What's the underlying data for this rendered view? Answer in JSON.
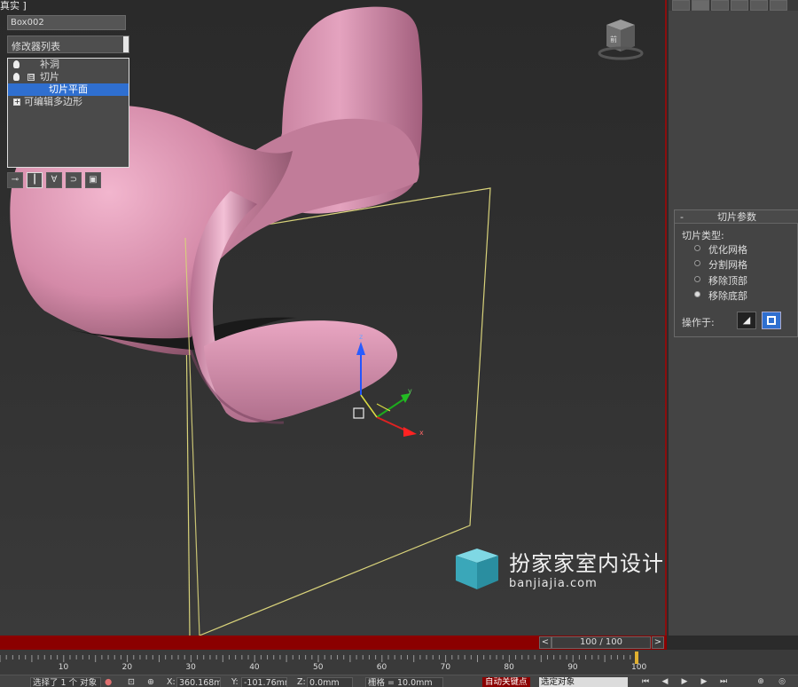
{
  "viewport": {
    "label": "真实 ]",
    "viewcube_label": "前",
    "axes": {
      "x": "x",
      "y": "y",
      "z": "z"
    }
  },
  "watermark": {
    "title": "扮家家室内设计",
    "url": "banjiajia.com"
  },
  "command_panel": {
    "object_name": "Box002",
    "modifier_list": "修改器列表",
    "stack": [
      {
        "label": "补洞"
      },
      {
        "label": "切片",
        "expand": "⊟"
      },
      {
        "label": "切片平面",
        "selected": true
      },
      {
        "label": "可编辑多边形",
        "expand": "+"
      }
    ],
    "rollout": {
      "title": "切片参数",
      "collapse": "-",
      "slice_type_label": "切片类型:",
      "options": [
        {
          "label": "优化网格",
          "selected": false
        },
        {
          "label": "分割网格",
          "selected": false
        },
        {
          "label": "移除顶部",
          "selected": false
        },
        {
          "label": "移除底部",
          "selected": true
        }
      ],
      "operate_on_label": "操作于:"
    }
  },
  "time_slider": {
    "frame_display": "100 / 100",
    "prev": "<",
    "next": ">",
    "ticks": [
      "10",
      "20",
      "30",
      "40",
      "50",
      "60",
      "70",
      "80",
      "90",
      "100"
    ]
  },
  "status_bar": {
    "selection": "选择了 1 个 对象",
    "x_label": "X:",
    "x_value": "360.168mm",
    "y_label": "Y:",
    "y_value": "-101.76mm",
    "z_label": "Z:",
    "z_value": "0.0mm",
    "grid": "栅格 = 10.0mm",
    "auto_key": "自动关键点",
    "selected_object": "选定对象"
  },
  "colors": {
    "chair": "#d48aa8",
    "selection_highlight": "#2f6fd0",
    "time_bar": "#8b0000",
    "slice_plane": "#d8d27a"
  }
}
